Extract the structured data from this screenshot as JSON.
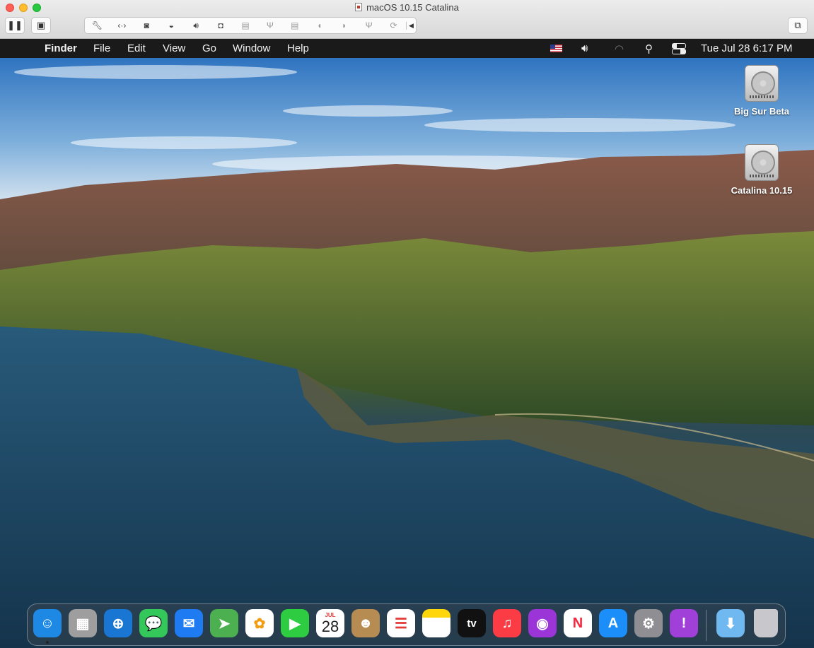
{
  "host_window": {
    "title": "macOS 10.15 Catalina",
    "device_icons": [
      "wrench-icon",
      "arrows-icon",
      "disk-icon",
      "hdd-icon",
      "speaker-icon",
      "camera-icon",
      "printer-icon",
      "usb-icon",
      "printer-icon",
      "mouse-icon",
      "mouse-icon",
      "usb-icon",
      "sync-icon"
    ]
  },
  "menubar": {
    "apple": "",
    "app_name": "Finder",
    "items": [
      "File",
      "Edit",
      "View",
      "Go",
      "Window",
      "Help"
    ],
    "clock": "Tue Jul 28  6:17 PM"
  },
  "desktop": {
    "disks": [
      {
        "label": "Big Sur Beta"
      },
      {
        "label": "Catalina 10.15"
      }
    ]
  },
  "dock": {
    "apps": [
      {
        "name": "finder",
        "glyph": "☺",
        "color": "#1e88e5",
        "running": true
      },
      {
        "name": "launchpad",
        "glyph": "▦",
        "color": "#9e9e9e"
      },
      {
        "name": "safari",
        "glyph": "⊕",
        "color": "#1976d2"
      },
      {
        "name": "messages",
        "glyph": "💬",
        "color": "#34c759"
      },
      {
        "name": "mail",
        "glyph": "✉",
        "color": "#1e7bf2"
      },
      {
        "name": "maps",
        "glyph": "➤",
        "color": "#4caf50"
      },
      {
        "name": "photos",
        "glyph": "✿",
        "color": "#ffffff"
      },
      {
        "name": "facetime",
        "glyph": "▶",
        "color": "#2ecc40"
      },
      {
        "name": "calendar",
        "glyph": "28",
        "month": "JUL",
        "color": "#ffffff"
      },
      {
        "name": "contacts",
        "glyph": "☻",
        "color": "#b78c52"
      },
      {
        "name": "reminders",
        "glyph": "☰",
        "color": "#ffffff"
      },
      {
        "name": "notes",
        "glyph": "",
        "color": "#ffd60a"
      },
      {
        "name": "tv",
        "glyph": "tv",
        "color": "#111111"
      },
      {
        "name": "music",
        "glyph": "♫",
        "color": "#fc3c44"
      },
      {
        "name": "podcasts",
        "glyph": "◉",
        "color": "#9b35d8"
      },
      {
        "name": "news",
        "glyph": "N",
        "color": "#ffffff"
      },
      {
        "name": "app-store",
        "glyph": "A",
        "color": "#1c8ef9"
      },
      {
        "name": "system-preferences",
        "glyph": "⚙",
        "color": "#8e8e93"
      },
      {
        "name": "feedback-assistant",
        "glyph": "!",
        "color": "#a040d8"
      },
      {
        "name": "downloads",
        "glyph": "⬇",
        "color": "#6fb9f0"
      },
      {
        "name": "trash",
        "glyph": "",
        "color": "#c7c7cc"
      }
    ]
  }
}
